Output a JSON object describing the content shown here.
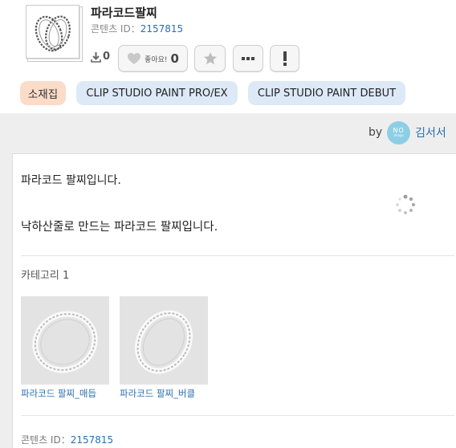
{
  "asset": {
    "title": "파라코드팔찌",
    "content_id_label": "콘텐츠 ID：",
    "content_id": "2157815"
  },
  "actions": {
    "download_count": "0",
    "like_label": "좋아요!",
    "like_count": "0"
  },
  "tags": [
    "소재집",
    "CLIP STUDIO PAINT PRO/EX",
    "CLIP STUDIO PAINT DEBUT"
  ],
  "author": {
    "by_label": "by",
    "avatar_text": "NO",
    "avatar_sub": "image",
    "name": "김서서"
  },
  "body": {
    "line1": "파라코드 팔찌입니다.",
    "line2": "낙하산줄로 만드는 파라코드 팔찌입니다.",
    "category": "카테고리 1",
    "items": [
      {
        "caption": "파라코드 팔찌_매듭"
      },
      {
        "caption": "파라코드 팔찌_버클"
      }
    ],
    "footer_id_label": "콘텐츠 ID：",
    "footer_id": "2157815"
  },
  "colors": {
    "link": "#2a6fb0",
    "tag_material": "#fbdcc8",
    "tag_app": "#dde9f7",
    "page_bg": "#eeeeee"
  },
  "icons": [
    "download-icon",
    "heart-icon",
    "star-icon",
    "more-icon",
    "report-icon",
    "loading-spinner-icon"
  ]
}
